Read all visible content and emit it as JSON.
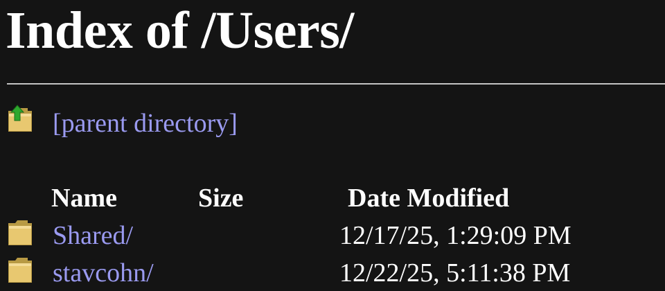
{
  "page": {
    "title": "Index of /Users/"
  },
  "parent": {
    "label": "[parent directory]",
    "icon": "folder-up-icon"
  },
  "table": {
    "headers": {
      "name": "Name",
      "size": "Size",
      "date": "Date Modified"
    },
    "rows": [
      {
        "name": "Shared/",
        "size": "",
        "date": "12/17/25, 1:29:09 PM",
        "icon": "folder-icon"
      },
      {
        "name": "stavcohn/",
        "size": "",
        "date": "12/22/25, 5:11:38 PM",
        "icon": "folder-icon"
      }
    ]
  },
  "colors": {
    "background": "#141414",
    "link": "#9a9af0",
    "text": "#ffffff",
    "rule": "#c4c4c4",
    "folder": "#e8c870",
    "arrow": "#2ea82e"
  }
}
